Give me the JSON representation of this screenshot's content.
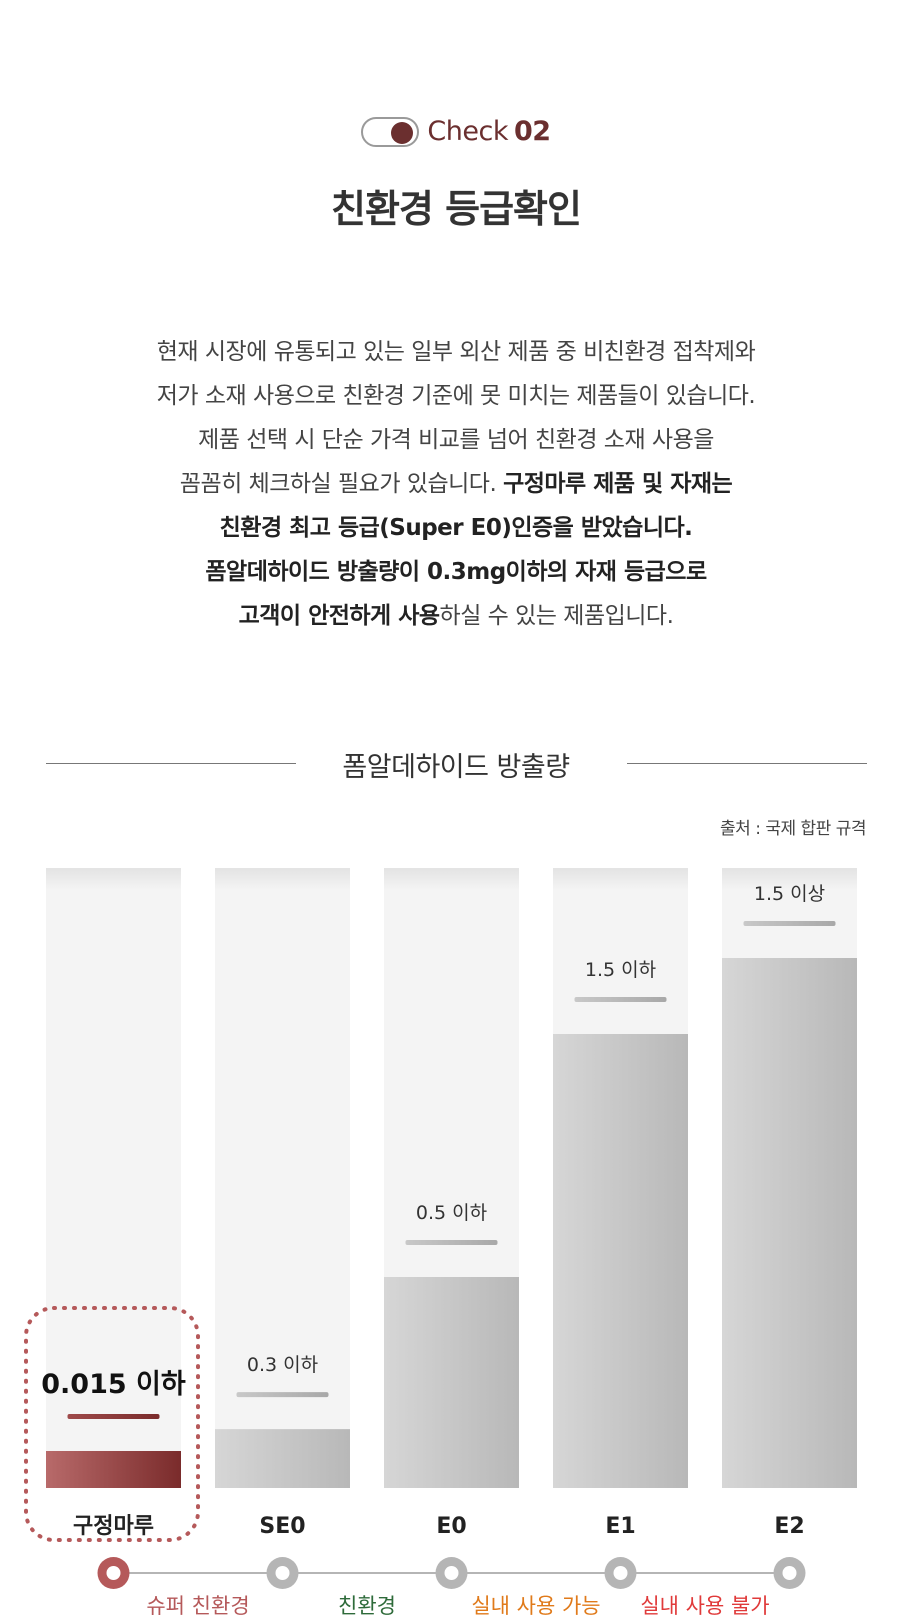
{
  "header": {
    "check_label": "Check",
    "check_number": "02",
    "title": "친환경 등급확인"
  },
  "description": {
    "line1": "현재 시장에 유통되고 있는 일부 외산 제품 중 비친환경 접착제와",
    "line2": "저가 소재 사용으로 친환경 기준에 못 미치는 제품들이 있습니다.",
    "line3": "제품 선택 시 단순 가격 비교를 넘어 친환경 소재 사용을",
    "line4_plain": "꼼꼼히 체크하실 필요가 있습니다. ",
    "line4_bold": "구정마루 제품 및 자재는",
    "line5_bold": "친환경 최고 등급(Super E0)인증을 받았습니다.",
    "line6_bold": "폼알데하이드 방출량이 0.3mg이하의 자재 등급으로",
    "line7_bold": "고객이 안전하게 사용",
    "line7_plain": "하실 수 있는 제품입니다."
  },
  "section": {
    "title": "폼알데하이드 방출량",
    "source": "출처 : 국제 합판 규격"
  },
  "colors": {
    "highlight": "#7a2b2b",
    "highlight_light": "#b86a6a",
    "bar_bg": "#f4f4f4",
    "bar_fill": "#c4c4c4",
    "timeline": "#b5b5b5",
    "super_eco": "#b5595a",
    "eco": "#2e6b3a",
    "indoor_ok": "#e07a1a",
    "indoor_no": "#e03a3a"
  },
  "chart_data": {
    "type": "bar",
    "categories": [
      "구정마루",
      "SE0",
      "E0",
      "E1",
      "E2"
    ],
    "values": [
      0.015,
      0.3,
      0.5,
      1.5,
      1.5
    ],
    "value_labels": [
      "0.015 이하",
      "0.3 이하",
      "0.5 이하",
      "1.5 이하",
      "1.5 이상"
    ],
    "highlight_index": 0,
    "ylim": [
      0,
      1.5
    ],
    "grid": false,
    "timeline_labels": [
      {
        "text": "슈퍼 친환경",
        "color_key": "super_eco"
      },
      {
        "text": "친환경",
        "color_key": "eco"
      },
      {
        "text": "실내 사용 가능",
        "color_key": "indoor_ok"
      },
      {
        "text": "실내 사용 불가",
        "color_key": "indoor_no"
      }
    ]
  }
}
